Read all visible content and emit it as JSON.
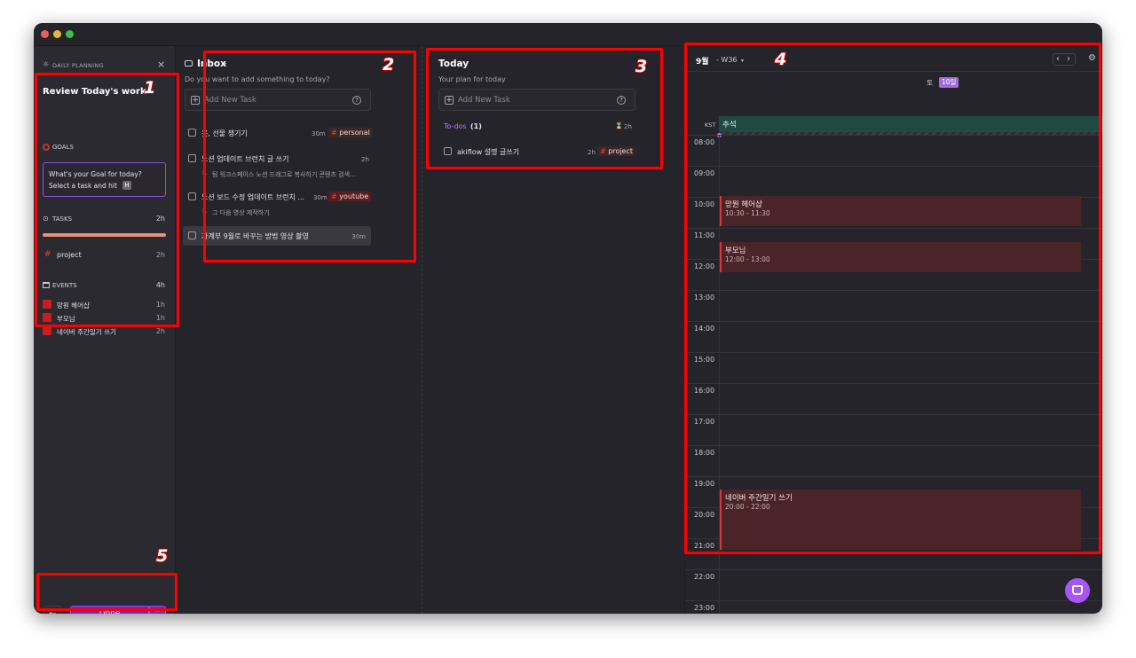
{
  "sidebar": {
    "header": "DAILY PLANNING",
    "title": "Review Today's work",
    "goals": {
      "label": "GOALS",
      "prompt_line1": "What's your Goal for today?",
      "prompt_line2": "Select a task and hit",
      "key": "H"
    },
    "tasks": {
      "label": "TASKS",
      "total": "2h",
      "items": [
        {
          "name": "project",
          "duration": "2h"
        }
      ]
    },
    "events": {
      "label": "EVENTS",
      "total": "4h",
      "items": [
        {
          "name": "망원 헤어샵",
          "duration": "1h"
        },
        {
          "name": "부모님",
          "duration": "1h"
        },
        {
          "name": "네이버 주간일기 쓰기",
          "duration": "2h"
        }
      ]
    },
    "footer": {
      "done": "Done"
    }
  },
  "inbox": {
    "title": "Inbox",
    "subtitle": "Do you want to add something to today?",
    "add_task": "Add New Task",
    "tasks": [
      {
        "title": "옷, 선물 챙기기",
        "duration": "30m",
        "tag": "personal",
        "note": ""
      },
      {
        "title": "노션 업데이트 브런치 글 쓰기",
        "duration": "2h",
        "tag": "",
        "note": "팀 워크스페이스 노션 드래그로 복사하기 콘텐츠 검색..."
      },
      {
        "title": "노션 보드 수정 업데이트 브런치 ...",
        "duration": "30m",
        "tag": "youtube",
        "note": "그 다음 영상 제작하기"
      },
      {
        "title": "가계부 9월로 바꾸는 방법 영상 촬영",
        "duration": "30m",
        "tag": "",
        "note": ""
      }
    ]
  },
  "today": {
    "title": "Today",
    "subtitle": "Your plan for today",
    "add_task": "Add New Task",
    "todos_label": "To-dos",
    "todos_count": "(1)",
    "todos_duration": "2h",
    "tasks": [
      {
        "title": "akiflow 설명 글쓰기",
        "duration": "2h",
        "tag": "project"
      }
    ]
  },
  "calendar": {
    "month": "9월",
    "week": "- W36",
    "day_label": "토",
    "day_badge": "10일",
    "timezone": "KST",
    "allday_event": "추석",
    "hours": [
      "08:00",
      "09:00",
      "10:00",
      "11:00",
      "12:00",
      "13:00",
      "14:00",
      "15:00",
      "16:00",
      "17:00",
      "18:00",
      "19:00",
      "20:00",
      "21:00",
      "22:00",
      "23:00"
    ],
    "events": [
      {
        "title": "망원 헤어샵",
        "time": "10:30 - 11:30"
      },
      {
        "title": "부모님",
        "time": "12:00 - 13:00"
      },
      {
        "title": "네이버 주간일기 쓰기",
        "time": "20:00 - 22:00"
      }
    ]
  },
  "annotations": [
    "1",
    "2",
    "3",
    "4",
    "5"
  ],
  "colors": {
    "accent": "#6d28c9",
    "event": "#e03535",
    "bg": "#25242b"
  }
}
